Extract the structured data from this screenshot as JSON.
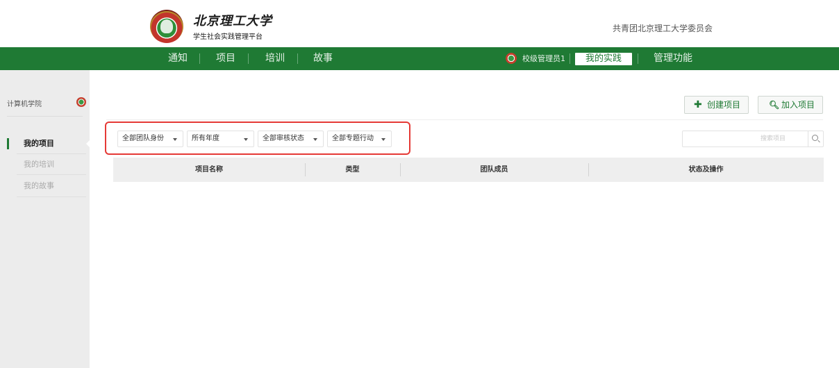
{
  "header": {
    "university_name": "北京理工大学",
    "platform_name": "学生社会实践管理平台",
    "organization": "共青团北京理工大学委员会"
  },
  "nav": {
    "items": [
      "通知",
      "项目",
      "培训",
      "故事"
    ],
    "admin_name": "校级管理员1",
    "active_item": "我的实践",
    "management": "管理功能"
  },
  "sidebar": {
    "college": "计算机学院",
    "items": [
      "我的项目",
      "我的培训",
      "我的故事"
    ],
    "active_index": 0
  },
  "actions": {
    "create_label": "创建项目",
    "create_icon": "plus-icon",
    "join_label": "加入项目",
    "join_icon": "search-icon"
  },
  "filters": {
    "team_role": "全部团队身份",
    "year": "所有年度",
    "review_status": "全部审核状态",
    "special_action": "全部专题行动"
  },
  "search": {
    "placeholder": "搜索项目",
    "value": ""
  },
  "table": {
    "columns": [
      "项目名称",
      "类型",
      "团队成员",
      "状态及操作"
    ],
    "rows": []
  },
  "colors": {
    "brand_green": "#1f7a34",
    "highlight_red": "#e53935",
    "sidebar_bg": "#ececec"
  }
}
